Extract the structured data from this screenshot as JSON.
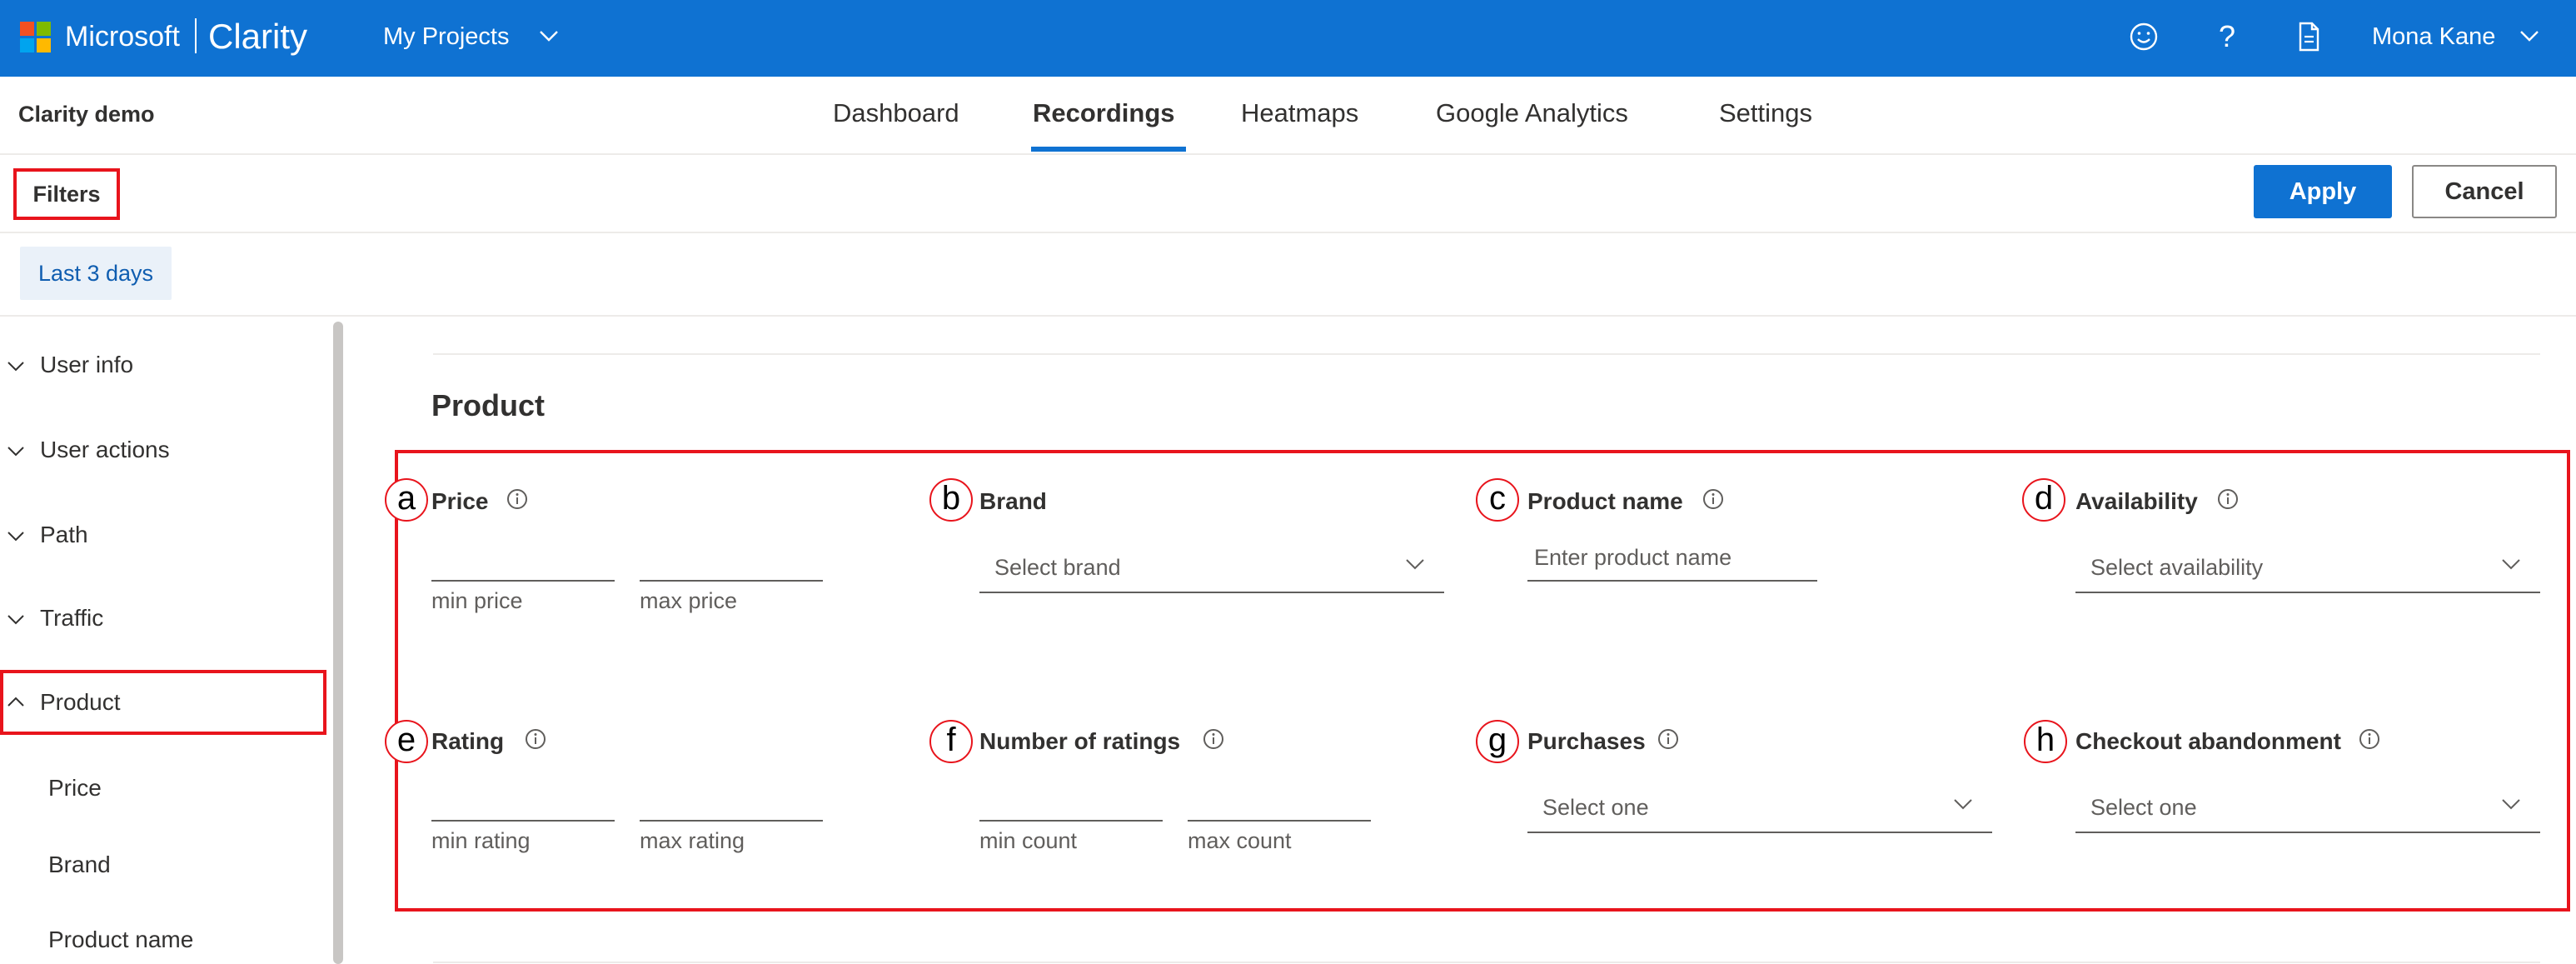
{
  "header": {
    "brand": "Microsoft",
    "product": "Clarity",
    "projects_menu": "My Projects",
    "user_name": "Mona Kane",
    "icons": [
      "smile-icon",
      "help-icon",
      "document-icon",
      "chevron-down-icon"
    ]
  },
  "nav": {
    "project_name": "Clarity demo",
    "tabs": [
      "Dashboard",
      "Recordings",
      "Heatmaps",
      "Google Analytics",
      "Settings"
    ],
    "active_tab": "Recordings"
  },
  "filters": {
    "label": "Filters",
    "apply": "Apply",
    "cancel": "Cancel",
    "date_chip": "Last 3 days"
  },
  "sidebar": {
    "items": [
      {
        "label": "User info"
      },
      {
        "label": "User actions"
      },
      {
        "label": "Path"
      },
      {
        "label": "Traffic"
      },
      {
        "label": "Product"
      }
    ],
    "sub_items": [
      "Price",
      "Brand",
      "Product name"
    ]
  },
  "product": {
    "title": "Product",
    "markers": [
      "a",
      "b",
      "c",
      "d",
      "e",
      "f",
      "g",
      "h"
    ],
    "price": {
      "label": "Price",
      "min_hint": "min price",
      "max_hint": "max price"
    },
    "brand": {
      "label": "Brand",
      "placeholder": "Select brand"
    },
    "product_name": {
      "label": "Product name",
      "placeholder": "Enter product name"
    },
    "availability": {
      "label": "Availability",
      "placeholder": "Select availability"
    },
    "rating": {
      "label": "Rating",
      "min_hint": "min rating",
      "max_hint": "max rating"
    },
    "number_of_ratings": {
      "label": "Number of ratings",
      "min_hint": "min count",
      "max_hint": "max count"
    },
    "purchases": {
      "label": "Purchases",
      "placeholder": "Select one"
    },
    "checkout_abandonment": {
      "label": "Checkout abandonment",
      "placeholder": "Select one"
    }
  },
  "colors": {
    "accent": "#0f72d2",
    "highlight": "#e8141c",
    "chip_bg": "#eaf1f9"
  }
}
